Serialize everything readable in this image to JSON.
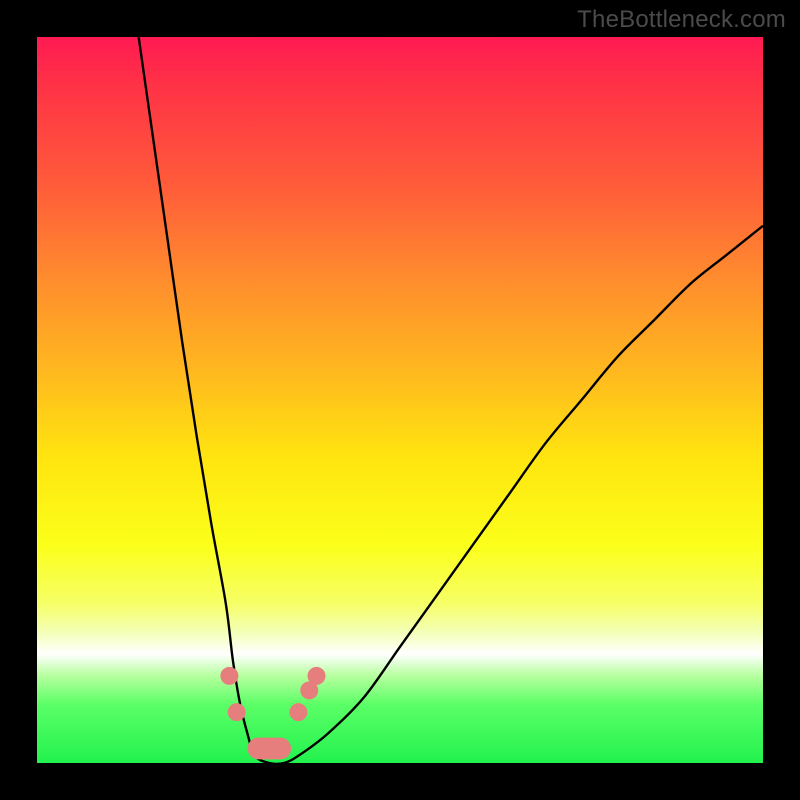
{
  "watermark": "TheBottleneck.com",
  "chart_data": {
    "type": "line",
    "title": "",
    "xlabel": "",
    "ylabel": "",
    "xlim": [
      0,
      100
    ],
    "ylim": [
      0,
      100
    ],
    "grid": false,
    "legend": false,
    "series": [
      {
        "name": "bottleneck-curve",
        "x": [
          14,
          16,
          18,
          20,
          22,
          24,
          26,
          27,
          28,
          29,
          30,
          32,
          34,
          36,
          40,
          45,
          50,
          55,
          60,
          65,
          70,
          75,
          80,
          85,
          90,
          95,
          100
        ],
        "y": [
          100,
          86,
          72,
          58,
          45,
          33,
          22,
          14,
          8,
          4,
          1,
          0,
          0,
          1,
          4,
          9,
          16,
          23,
          30,
          37,
          44,
          50,
          56,
          61,
          66,
          70,
          74
        ]
      }
    ],
    "markers": {
      "dots": [
        {
          "x": 26.5,
          "y": 12
        },
        {
          "x": 27.5,
          "y": 7
        },
        {
          "x": 36.0,
          "y": 7
        },
        {
          "x": 37.5,
          "y": 10
        },
        {
          "x": 38.5,
          "y": 12
        }
      ],
      "bar": {
        "x_start": 29,
        "x_end": 35,
        "y": 0.5,
        "height": 3
      }
    }
  }
}
